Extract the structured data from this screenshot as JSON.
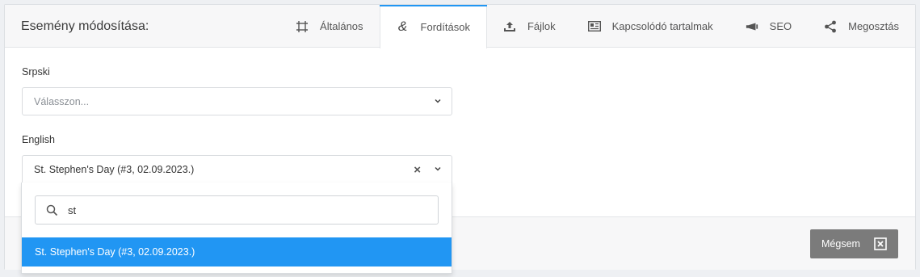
{
  "header": {
    "title": "Esemény módosítása:",
    "tabs": [
      {
        "label": "Általános",
        "icon": "frame-icon"
      },
      {
        "label": "Fordítások",
        "icon": "ampersand-icon",
        "active": true
      },
      {
        "label": "Fájlok",
        "icon": "upload-icon"
      },
      {
        "label": "Kapcsolódó tartalmak",
        "icon": "newspaper-icon"
      },
      {
        "label": "SEO",
        "icon": "megaphone-icon"
      },
      {
        "label": "Megosztás",
        "icon": "share-icon"
      }
    ]
  },
  "form": {
    "srpski_label": "Srpski",
    "srpski_placeholder": "Válasszon...",
    "english_label": "English",
    "english_value": "St. Stephen's Day (#3, 02.09.2023.)",
    "clear_symbol": "×"
  },
  "dropdown": {
    "search_value": "st",
    "options": [
      "St. Stephen's Day (#3, 02.09.2023.)"
    ]
  },
  "footer": {
    "cancel_label": "Mégsem"
  },
  "colors": {
    "accent": "#2196f3",
    "cancel_bg": "#7b7b7b"
  }
}
